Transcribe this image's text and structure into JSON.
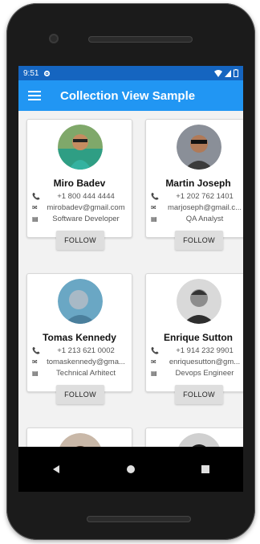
{
  "status_bar": {
    "time": "9:51"
  },
  "app_bar": {
    "title": "Collection View Sample"
  },
  "people": [
    {
      "name": "Miro Badev",
      "phone": "+1 800 444 4444",
      "email": "mirobadev@gmail.com",
      "role": "Software Developer",
      "follow": "FOLLOW"
    },
    {
      "name": "Martin Joseph",
      "phone": "+1 202 762 1401",
      "email": "marjoseph@gmail.c...",
      "role": "QA Analyst",
      "follow": "FOLLOW"
    },
    {
      "name": "Tomas Kennedy",
      "phone": "+1 213 621 0002",
      "email": "tomaskennedy@gma...",
      "role": "Technical Arhitect",
      "follow": "FOLLOW"
    },
    {
      "name": "Enrique Sutton",
      "phone": "+1 914 232 9901",
      "email": "enriquesutton@gm...",
      "role": "Devops Engineer",
      "follow": "FOLLOW"
    }
  ],
  "icons": [
    "menu-icon",
    "settings-icon",
    "wifi-icon",
    "signal-icon",
    "battery-icon",
    "phone-icon",
    "email-icon",
    "role-icon",
    "back-icon",
    "home-icon",
    "recents-icon"
  ],
  "colors": {
    "app_bar": "#2196f3",
    "status_bar": "#1565c0",
    "button": "#dedede"
  }
}
